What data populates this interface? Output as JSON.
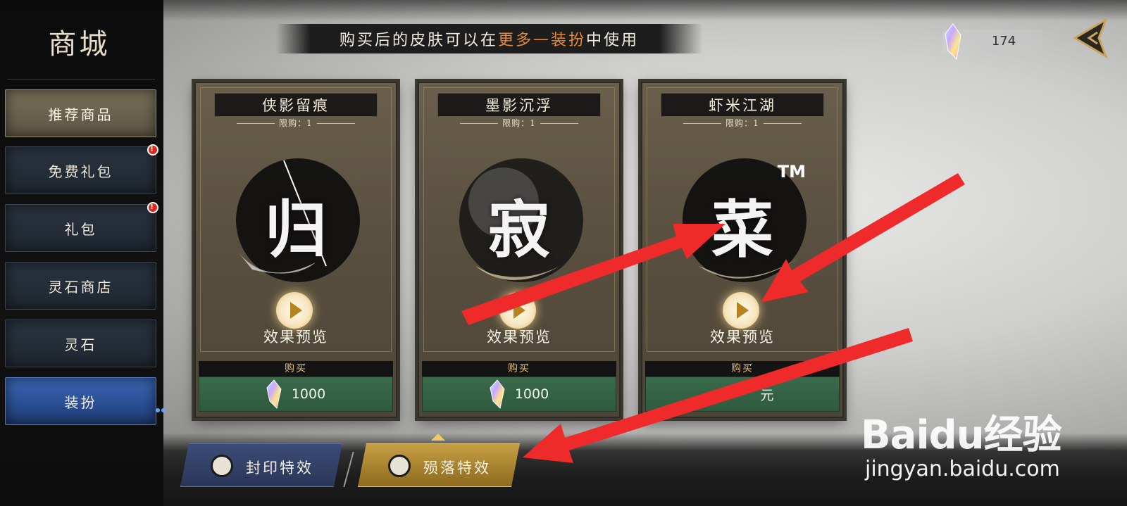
{
  "sidebar": {
    "title": "商城",
    "items": [
      {
        "label": "推荐商品",
        "badge": false
      },
      {
        "label": "免费礼包",
        "badge": true
      },
      {
        "label": "礼包",
        "badge": true
      },
      {
        "label": "灵石商店",
        "badge": false
      },
      {
        "label": "灵石",
        "badge": false
      },
      {
        "label": "装扮",
        "badge": false,
        "active": true
      }
    ],
    "badge_symbol": "!"
  },
  "banner": {
    "text_before": "购买后的皮肤可以在",
    "highlight_1": "更多",
    "separator": "—",
    "highlight_2": "装扮",
    "text_after": "中使用"
  },
  "currency": {
    "icon": "crystal-icon",
    "value": "174"
  },
  "cards": [
    {
      "title": "侠影留痕",
      "limit": "限购：1",
      "glyph": "归",
      "preview_label": "效果预览",
      "buy_label": "购买",
      "price": "1000",
      "price_icon": "crystal-icon"
    },
    {
      "title": "墨影沉浮",
      "limit": "限购：1",
      "glyph": "寂",
      "preview_label": "效果预览",
      "buy_label": "购买",
      "price": "1000",
      "price_icon": "crystal-icon"
    },
    {
      "title": "虾米江湖",
      "limit": "限购：1",
      "glyph": "菜",
      "trademark": "TM",
      "preview_label": "效果预览",
      "buy_label": "购买",
      "price": "元",
      "price_icon": null
    }
  ],
  "tabs": [
    {
      "label": "封印特效",
      "active": false
    },
    {
      "label": "殒落特效",
      "active": true
    }
  ],
  "watermark": {
    "brand": "Baidu经验",
    "url": "jingyan.baidu.com"
  },
  "colors": {
    "accent_orange": "#e58b35",
    "buy_green": "#3b6a4b",
    "arrow_red": "#ee2a2a",
    "active_blue": "#3c66b4",
    "gold": "#c7a045"
  }
}
